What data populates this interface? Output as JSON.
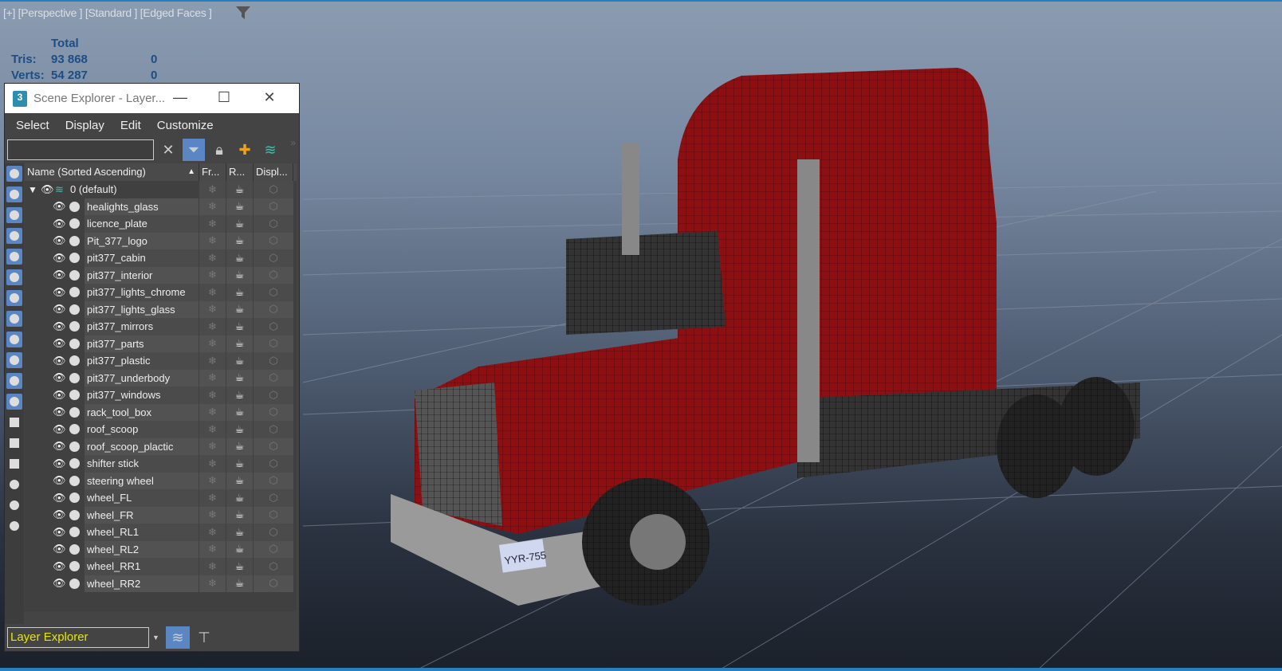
{
  "viewport": {
    "label": "[+] [Perspective ] [Standard ] [Edged Faces ]",
    "stats": {
      "header": "Total",
      "tris_label": "Tris:",
      "tris_value": "93 868",
      "tris_sel": "0",
      "verts_label": "Verts:",
      "verts_value": "54 287",
      "verts_sel": "0"
    },
    "plate_text": "YYR-755"
  },
  "panel": {
    "title": "Scene Explorer - Layer...",
    "app_icon": "3",
    "menu": [
      "Select",
      "Display",
      "Edit",
      "Customize"
    ],
    "search": {
      "value": "",
      "placeholder": ""
    },
    "columns": [
      "Name (Sorted Ascending)",
      "Fr...",
      "R...",
      "Displ..."
    ],
    "root_layer": "0 (default)",
    "layers": [
      "healights_glass",
      "licence_plate",
      "Pit_377_logo",
      "pit377_cabin",
      "pit377_interior",
      "pit377_lights_chrome",
      "pit377_lights_glass",
      "pit377_mirrors",
      "pit377_parts",
      "pit377_plastic",
      "pit377_underbody",
      "pit377_windows",
      "rack_tool_box",
      "roof_scoop",
      "roof_scoop_plactic",
      "shifter stick",
      "steering wheel",
      "wheel_FL",
      "wheel_FR",
      "wheel_RL1",
      "wheel_RL2",
      "wheel_RR1",
      "wheel_RR2"
    ],
    "explorer_mode": "Layer Explorer"
  },
  "colors": {
    "accent": "#5a87c4",
    "truck_red": "#8e0f12",
    "mode_text": "#e6e600"
  }
}
